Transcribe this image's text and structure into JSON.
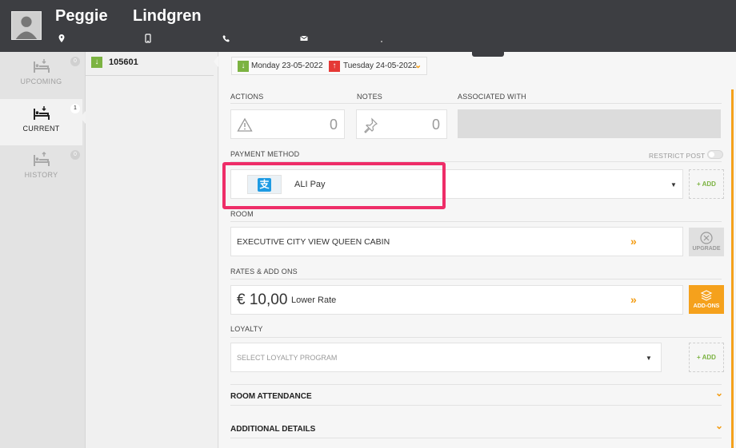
{
  "guest": {
    "first_name": "Peggie",
    "last_name": "Lindgren"
  },
  "nav": [
    {
      "label": "UPCOMING",
      "count": "0"
    },
    {
      "label": "CURRENT",
      "count": "1"
    },
    {
      "label": "HISTORY",
      "count": "0"
    }
  ],
  "reservation": {
    "number": "105601"
  },
  "dates": {
    "arrival": "Monday 23-05-2022",
    "departure": "Tuesday 24-05-2022"
  },
  "sections": {
    "actions": "ACTIONS",
    "notes": "NOTES",
    "associated_with": "ASSOCIATED WITH",
    "payment_method": "PAYMENT METHOD",
    "restrict_post": "RESTRICT POST",
    "room": "ROOM",
    "rates_addons": "RATES & ADD ONS",
    "loyalty": "LOYALTY",
    "room_attendance": "ROOM ATTENDANCE",
    "additional_details": "ADDITIONAL DETAILS"
  },
  "counts": {
    "actions": "0",
    "notes": "0"
  },
  "payment": {
    "method": "ALI Pay",
    "add_label": "+ ADD"
  },
  "room": {
    "name": "EXECUTIVE CITY VIEW QUEEN CABIN",
    "upgrade_label": "UPGRADE"
  },
  "rate": {
    "amount": "€ 10,00",
    "name": "Lower Rate",
    "addons_label": "ADD-ONS"
  },
  "loyalty": {
    "placeholder": "SELECT LOYALTY PROGRAM",
    "add_label": "+ ADD"
  },
  "colors": {
    "header": "#3d3e42",
    "accent": "#f5a11c",
    "green": "#7cb342",
    "highlight": "#ee2d68",
    "alipay": "#1e9be3"
  }
}
